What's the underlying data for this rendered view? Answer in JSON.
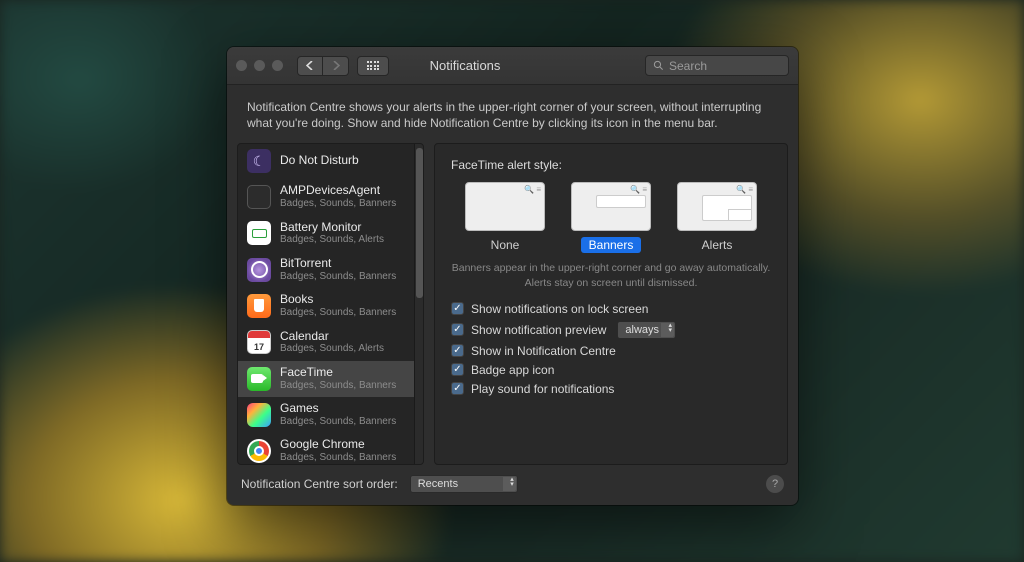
{
  "window": {
    "title": "Notifications"
  },
  "search": {
    "placeholder": "Search"
  },
  "description": "Notification Centre shows your alerts in the upper-right corner of your screen, without interrupting what you're doing. Show and hide Notification Centre by clicking its icon in the menu bar.",
  "apps": [
    {
      "name": "Do Not Disturb",
      "sub": ""
    },
    {
      "name": "AMPDevicesAgent",
      "sub": "Badges, Sounds, Banners"
    },
    {
      "name": "Battery Monitor",
      "sub": "Badges, Sounds, Alerts"
    },
    {
      "name": "BitTorrent",
      "sub": "Badges, Sounds, Banners"
    },
    {
      "name": "Books",
      "sub": "Badges, Sounds, Banners"
    },
    {
      "name": "Calendar",
      "sub": "Badges, Sounds, Alerts"
    },
    {
      "name": "FaceTime",
      "sub": "Badges, Sounds, Banners"
    },
    {
      "name": "Games",
      "sub": "Badges, Sounds, Banners"
    },
    {
      "name": "Google Chrome",
      "sub": "Badges, Sounds, Banners"
    }
  ],
  "selected_app_index": 6,
  "detail": {
    "style_label": "FaceTime alert style:",
    "styles": {
      "none": "None",
      "banners": "Banners",
      "alerts": "Alerts"
    },
    "selected_style": "banners",
    "note": "Banners appear in the upper-right corner and go away automatically. Alerts stay on screen until dismissed.",
    "checks": {
      "lock": "Show notifications on lock screen",
      "preview": "Show notification preview",
      "centre": "Show in Notification Centre",
      "badge": "Badge app icon",
      "sound": "Play sound for notifications"
    },
    "preview_select": "always"
  },
  "footer": {
    "sort_label": "Notification Centre sort order:",
    "sort_value": "Recents"
  }
}
